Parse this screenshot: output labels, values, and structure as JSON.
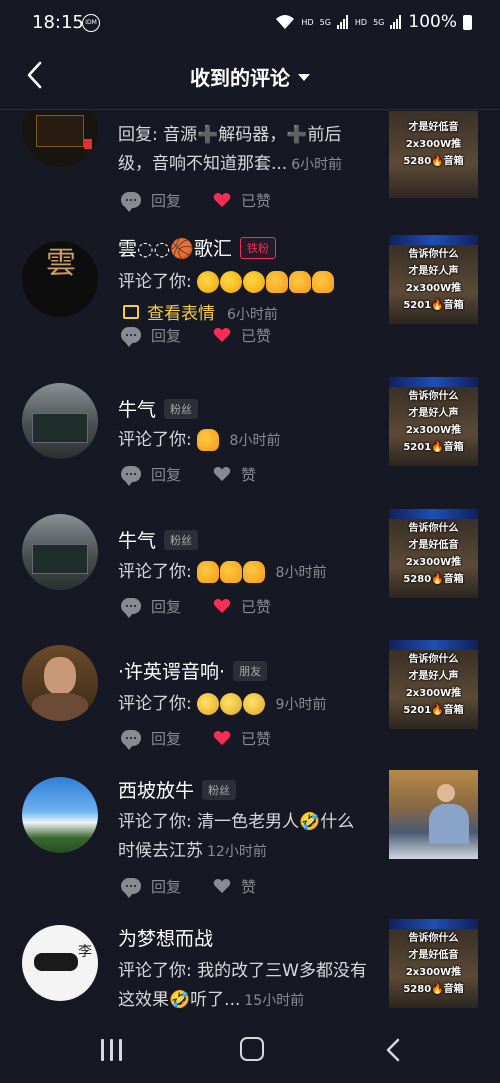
{
  "status_bar": {
    "time": "18:15",
    "idm": "IDM",
    "hd1": "HD",
    "net1": "5G",
    "hd2": "HD",
    "net2": "5G",
    "battery": "100%"
  },
  "header": {
    "title": "收到的评论"
  },
  "comments": [
    {
      "name": "",
      "badge": "",
      "prefix": "回复: 音源➕解码器，➕前后级，音响不知道那套...",
      "time": "6小时前",
      "reply_label": "回复",
      "like_label": "已赞",
      "liked": true,
      "thumb_lines": [
        "才是好低音",
        "2x300W推",
        "5280🔥音箱"
      ]
    },
    {
      "name": "雲◌◌🏀歌汇",
      "badge": "铁粉",
      "prefix": "评论了你:",
      "emojis": [
        "clap",
        "clap",
        "clap",
        "thumb",
        "thumb",
        "thumb"
      ],
      "view_emoji": "查看表情",
      "time": "6小时前",
      "reply_label": "回复",
      "like_label": "已赞",
      "liked": true,
      "thumb_lines": [
        "告诉你什么",
        "才是好人声",
        "2x300W推",
        "5201🔥音箱"
      ]
    },
    {
      "name": "牛气",
      "badge": "粉丝",
      "prefix": "评论了你:",
      "emojis": [
        "thumb"
      ],
      "time": "8小时前",
      "reply_label": "回复",
      "like_label": "赞",
      "liked": false,
      "thumb_lines": [
        "告诉你什么",
        "才是好人声",
        "2x300W推",
        "5201🔥音箱"
      ]
    },
    {
      "name": "牛气",
      "badge": "粉丝",
      "prefix": "评论了你:",
      "emojis": [
        "thumb",
        "thumb",
        "thumb"
      ],
      "time": "8小时前",
      "reply_label": "回复",
      "like_label": "已赞",
      "liked": true,
      "thumb_lines": [
        "告诉你什么",
        "才是好低音",
        "2x300W推",
        "5280🔥音箱"
      ]
    },
    {
      "name": "·许英谔音响·",
      "badge": "朋友",
      "prefix": "评论了你:",
      "emojis": [
        "sad",
        "sad",
        "sad"
      ],
      "time": "9小时前",
      "reply_label": "回复",
      "like_label": "已赞",
      "liked": true,
      "thumb_lines": [
        "告诉你什么",
        "才是好人声",
        "2x300W推",
        "5201🔥音箱"
      ]
    },
    {
      "name": "西坡放牛",
      "badge": "粉丝",
      "prefix": "评论了你: 清一色老男人🤣什么时候去江苏",
      "time": "12小时前",
      "reply_label": "回复",
      "like_label": "赞",
      "liked": false,
      "thumb_lines": []
    },
    {
      "name": "为梦想而战",
      "badge": "",
      "prefix": "评论了你: 我的改了三W多都没有这效果🤣听了...",
      "time": "15小时前",
      "reply_label": "",
      "like_label": "",
      "liked": false,
      "thumb_lines": [
        "告诉你什么",
        "才是好低音",
        "2x300W推",
        "5280🔥音箱"
      ]
    }
  ],
  "colors": {
    "background": "#161823",
    "like_red": "#fe2c55",
    "muted": "#8a8b91",
    "view_emoji": "#f7c948"
  }
}
